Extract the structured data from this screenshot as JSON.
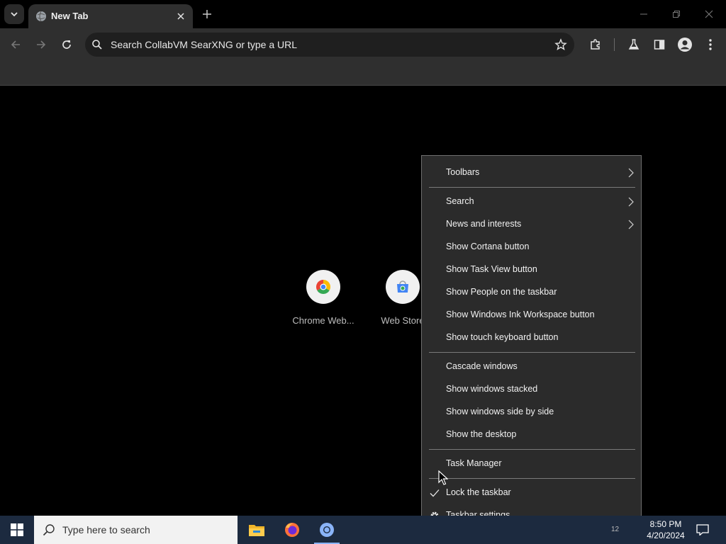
{
  "browser": {
    "tab_title": "New Tab",
    "omnibox_placeholder": "Search CollabVM SearXNG or type a URL"
  },
  "page": {
    "shortcuts": [
      {
        "label": "Chrome Web...",
        "icon": "chrome-icon"
      },
      {
        "label": "Web Store",
        "icon": "web-store-icon"
      }
    ]
  },
  "context_menu": {
    "items": [
      {
        "label": "Toolbars",
        "submenu": true
      },
      {
        "label": "Search",
        "submenu": true
      },
      {
        "label": "News and interests",
        "submenu": true
      },
      {
        "label": "Show Cortana button"
      },
      {
        "label": "Show Task View button"
      },
      {
        "label": "Show People on the taskbar"
      },
      {
        "label": "Show Windows Ink Workspace button"
      },
      {
        "label": "Show touch keyboard button"
      },
      {
        "label": "Cascade windows"
      },
      {
        "label": "Show windows stacked"
      },
      {
        "label": "Show windows side by side"
      },
      {
        "label": "Show the desktop"
      },
      {
        "label": "Task Manager"
      },
      {
        "label": "Lock the taskbar",
        "checked": true
      },
      {
        "label": "Taskbar settings",
        "icon": "gear-icon"
      }
    ]
  },
  "taskbar": {
    "search_placeholder": "Type here to search",
    "time": "8:50 PM",
    "date": "4/20/2024",
    "tray_text": "12"
  },
  "colors": {
    "taskbar": "#1c2a3f",
    "menu_bg": "#2b2b2b",
    "toolbar": "#2f2f2f"
  }
}
